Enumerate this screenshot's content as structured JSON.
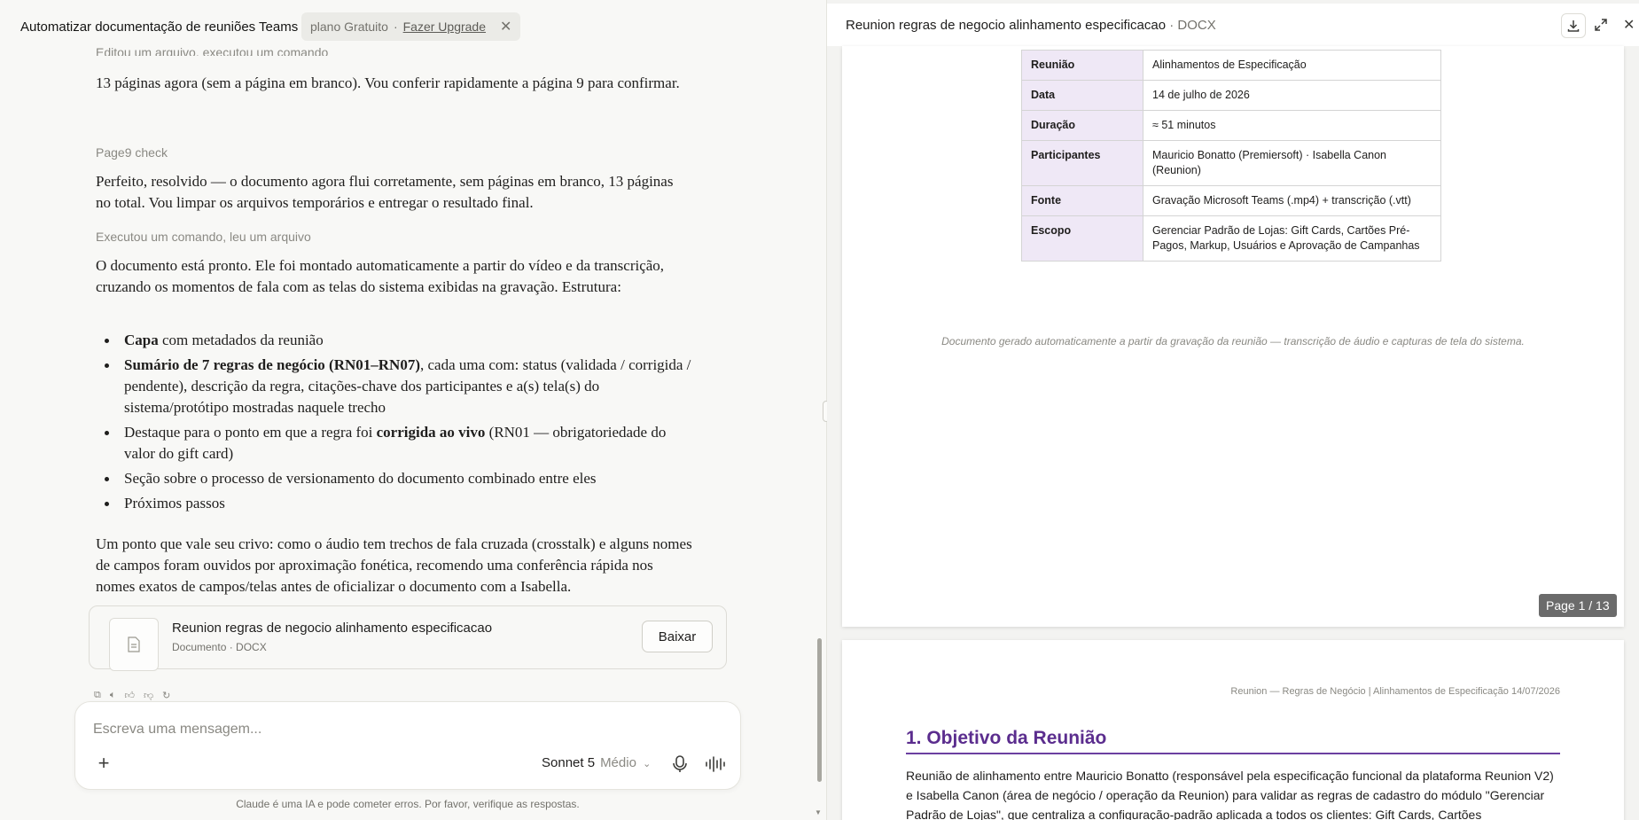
{
  "chat": {
    "title": "Automatizar documentação de reuniões Teams c",
    "plan": "plano Gratuito",
    "plan_sep": "·",
    "upgrade_label": "Fazer Upgrade",
    "messages": {
      "meta_top": "Editou um arquivo, executou um comando",
      "p1": "13 páginas agora (sem a página em branco). Vou conferir rapidamente a página 9 para confirmar.",
      "meta_page9": "Page9 check",
      "p2": "Perfeito, resolvido — o documento agora flui corretamente, sem páginas em branco, 13 páginas no total. Vou limpar os arquivos temporários e entregar o resultado final.",
      "meta_exec": "Executou um comando, leu um arquivo",
      "p3": "O documento está pronto. Ele foi montado automaticamente a partir do vídeo e da transcrição, cruzando os momentos de fala com as telas do sistema exibidas na gravação. Estrutura:",
      "bullet1_bold": "Capa",
      "bullet1_rest": " com metadados da reunião",
      "bullet2_bold": "Sumário de 7 regras de negócio (RN01–RN07)",
      "bullet2_rest": ", cada uma com: status (validada / corrigida / pendente), descrição da regra, citações-chave dos participantes e a(s) tela(s) do sistema/protótipo mostradas naquele trecho",
      "bullet3_pre": "Destaque para o ponto em que a regra foi ",
      "bullet3_bold": "corrigida ao vivo",
      "bullet3_post": " (RN01 — obrigatoriedade do valor do gift card)",
      "bullet4": "Seção sobre o processo de versionamento do documento combinado entre eles",
      "bullet5": "Próximos passos",
      "p4": "Um ponto que vale seu crivo: como o áudio tem trechos de fala cruzada (crosstalk) e alguns nomes de campos foram ouvidos por aproximação fonética, recomendo uma conferência rápida nos nomes exatos de campos/telas antes de oficializar o documento com a Isabella."
    },
    "file_card": {
      "name": "Reunion regras de negocio alinhamento especificacao",
      "sub": "Documento · DOCX",
      "download_label": "Baixar"
    },
    "composer": {
      "placeholder": "Escreva uma mensagem...",
      "model": "Sonnet 5",
      "effort": "Médio"
    },
    "disclaimer": "Claude é uma IA e pode cometer erros. Por favor, verifique as respostas."
  },
  "preview": {
    "title": "Reunion regras de negocio alinhamento especificacao",
    "format": "· DOCX",
    "meta_rows": [
      {
        "k": "Reunião",
        "v": "Alinhamentos de Especificação"
      },
      {
        "k": "Data",
        "v": "14 de julho de 2026"
      },
      {
        "k": "Duração",
        "v": "≈ 51 minutos"
      },
      {
        "k": "Participantes",
        "v": "Mauricio Bonatto (Premiersoft) · Isabella Canon (Reunion)"
      },
      {
        "k": "Fonte",
        "v": "Gravação Microsoft Teams (.mp4) + transcrição (.vtt)"
      },
      {
        "k": "Escopo",
        "v": "Gerenciar Padrão de Lojas: Gift Cards, Cartões Pré-Pagos, Markup, Usuários e Aprovação de Campanhas"
      }
    ],
    "footnote": "Documento gerado automaticamente a partir da gravação da reunião — transcrição de áudio e capturas de tela do sistema.",
    "page_badge": "Page 1 / 13",
    "page2_header": "Reunion — Regras de Negócio | Alinhamentos de Especificação 14/07/2026",
    "page2_h1": "1. Objetivo da Reunião",
    "page2_body": "Reunião de alinhamento entre Mauricio Bonatto (responsável pela especificação funcional da plataforma Reunion V2) e Isabella Canon (área de negócio / operação da Reunion) para validar as regras de cadastro do módulo \"Gerenciar Padrão de Lojas\", que centraliza a configuração-padrão aplicada a todos os clientes: Gift Cards, Cartões"
  },
  "colors": {
    "table_key_bg": "#efe8f6",
    "heading_purple": "#5b2d8e",
    "badge_bg": "#6b6b6b"
  },
  "icons": [
    "close-icon",
    "file-doc-icon",
    "copy-icon",
    "speaker-icon",
    "thumbs-up-icon",
    "thumbs-down-icon",
    "retry-icon",
    "plus-icon",
    "chevron-down-icon",
    "mic-icon",
    "voice-wave-icon",
    "download-icon",
    "expand-icon"
  ]
}
